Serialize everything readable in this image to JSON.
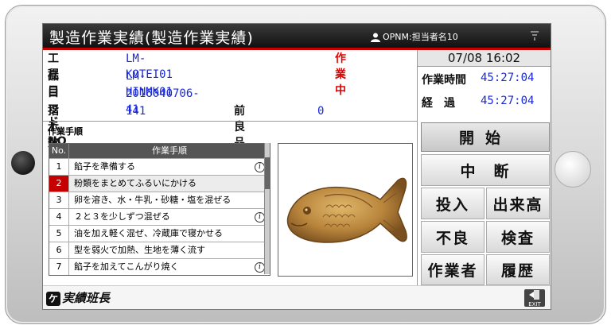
{
  "app": {
    "title": "製造作業実績(製造作業実績)",
    "operator": "OPNM:担当者名10"
  },
  "work": {
    "process_code_label": "工程コード",
    "process_code": "LM-KOTEI01",
    "status": "作業中",
    "item_label": "品目",
    "item": "LM-HINMK01",
    "lot_label": "ロットNO",
    "lot": "2016040706-41",
    "instr_label": "指示数",
    "instr": "141",
    "prev_good_label": "前良品",
    "prev_good": "0"
  },
  "timer": {
    "datetime": "07/08 16:02",
    "work_time_label": "作業時間",
    "work_time": "45:27:04",
    "elapsed_label": "経　過",
    "elapsed": "45:27:04"
  },
  "procedure": {
    "section_label": "作業手順",
    "col_no": "No.",
    "col_name": "作業手順",
    "steps": [
      {
        "no": "1",
        "name": "餡子を準備する",
        "info": true
      },
      {
        "no": "2",
        "name": "粉類をまとめてふるいにかける",
        "info": false
      },
      {
        "no": "3",
        "name": "卵を溶き、水・牛乳・砂糖・塩を混ぜる",
        "info": false
      },
      {
        "no": "4",
        "name": "２と３を少しずつ混ぜる",
        "info": true
      },
      {
        "no": "5",
        "name": "油を加え軽く混ぜ、冷蔵庫で寝かせる",
        "info": false
      },
      {
        "no": "6",
        "name": "型を弱火で加熱、生地を薄く流す",
        "info": false
      },
      {
        "no": "7",
        "name": "餡子を加えてこんがり焼く",
        "info": true
      }
    ],
    "selected": "2"
  },
  "buttons": {
    "start": "開始",
    "pause": "中　断",
    "input": "投入",
    "output": "出来高",
    "defect": "不良",
    "inspect": "検査",
    "worker": "作業者",
    "history": "履歴"
  },
  "footer": {
    "logo": "実績班長",
    "exit": "EXIT"
  },
  "colors": {
    "accent": "#c40000",
    "value_blue": "#1a28d8"
  }
}
